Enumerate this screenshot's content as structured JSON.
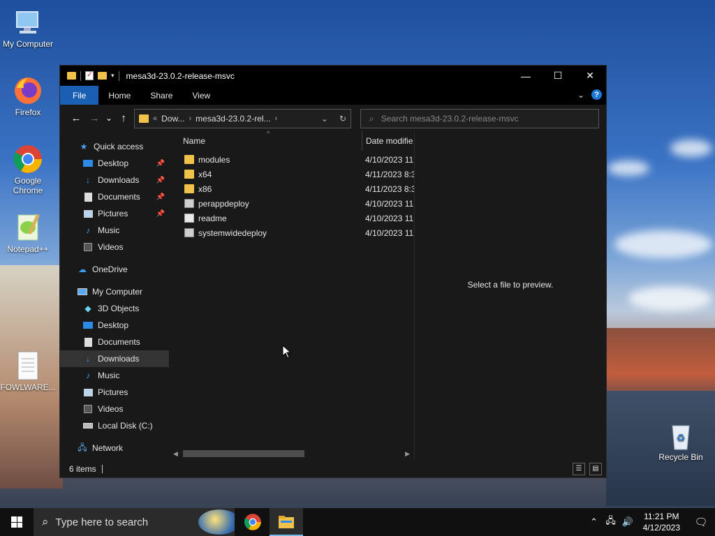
{
  "desktop": {
    "icons": [
      {
        "label": "My Computer"
      },
      {
        "label": "Firefox"
      },
      {
        "label": "Google Chrome"
      },
      {
        "label": "Notepad++"
      },
      {
        "label": "FOWLWARE..."
      },
      {
        "label": "Recycle Bin"
      }
    ]
  },
  "window": {
    "title": "mesa3d-23.0.2-release-msvc",
    "controls": {
      "minimize": "—",
      "maximize": "☐",
      "close": "✕"
    }
  },
  "ribbon": {
    "tabs": [
      "File",
      "Home",
      "Share",
      "View"
    ],
    "help": "?"
  },
  "nav": {
    "back": "←",
    "forward": "→",
    "recent": "⌄",
    "up": "↑",
    "address": {
      "overflow": "«",
      "segments": [
        "Dow...",
        "mesa3d-23.0.2-rel..."
      ]
    },
    "search_placeholder": "Search mesa3d-23.0.2-release-msvc"
  },
  "navpane": {
    "items": [
      {
        "label": "Quick access",
        "icon": "star-icon"
      },
      {
        "label": "Desktop",
        "icon": "desktop-icon",
        "pinned": true
      },
      {
        "label": "Downloads",
        "icon": "download-icon",
        "pinned": true
      },
      {
        "label": "Documents",
        "icon": "document-icon",
        "pinned": true
      },
      {
        "label": "Pictures",
        "icon": "picture-icon",
        "pinned": true
      },
      {
        "label": "Music",
        "icon": "music-icon"
      },
      {
        "label": "Videos",
        "icon": "video-icon"
      },
      {
        "label": "OneDrive",
        "icon": "cloud-icon"
      },
      {
        "label": "My Computer",
        "icon": "computer-icon"
      },
      {
        "label": "3D Objects",
        "icon": "cube-icon"
      },
      {
        "label": "Desktop",
        "icon": "desktop-icon"
      },
      {
        "label": "Documents",
        "icon": "document-icon"
      },
      {
        "label": "Downloads",
        "icon": "download-icon",
        "selected": true
      },
      {
        "label": "Music",
        "icon": "music-icon"
      },
      {
        "label": "Pictures",
        "icon": "picture-icon"
      },
      {
        "label": "Videos",
        "icon": "video-icon"
      },
      {
        "label": "Local Disk (C:)",
        "icon": "drive-icon"
      },
      {
        "label": "Network",
        "icon": "network-icon"
      }
    ]
  },
  "files": {
    "columns": {
      "name": "Name",
      "date": "Date modifie"
    },
    "rows": [
      {
        "name": "modules",
        "date": "4/10/2023 11:",
        "type": "folder"
      },
      {
        "name": "x64",
        "date": "4/11/2023 8:3",
        "type": "folder"
      },
      {
        "name": "x86",
        "date": "4/11/2023 8:3",
        "type": "folder"
      },
      {
        "name": "perappdeploy",
        "date": "4/10/2023 11:",
        "type": "cfg"
      },
      {
        "name": "readme",
        "date": "4/10/2023 11:",
        "type": "doc"
      },
      {
        "name": "systemwidedeploy",
        "date": "4/10/2023 11:",
        "type": "cfg"
      }
    ]
  },
  "preview": {
    "text": "Select a file to preview."
  },
  "status": {
    "count": "6 items"
  },
  "taskbar": {
    "search_placeholder": "Type here to search",
    "time": "11:21 PM",
    "date": "4/12/2023"
  }
}
